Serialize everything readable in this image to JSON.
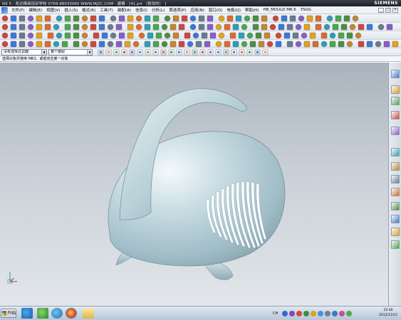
{
  "window": {
    "title": "NX 5 - 凯达模具培训学校  0769-88033060  WWW.MJZC.COM - 建模 - [41.prt （修改的） ]",
    "brand": "SIEMENS"
  },
  "menu": {
    "items": [
      "文件(F)",
      "编辑(E)",
      "视图(V)",
      "插入(S)",
      "格式(R)",
      "工具(T)",
      "装配(A)",
      "信息(I)",
      "分析(L)",
      "首选项(P)",
      "应用(N)",
      "窗口(O)",
      "电极(Q)",
      "帮助(H)",
      "HB_MOULD M6.6",
      "YSUG"
    ],
    "window_controls": [
      "_",
      "□",
      "×"
    ]
  },
  "selection_bar": {
    "filter_value": "没有选择过滤器",
    "scope_value": "整个装配"
  },
  "cue_line": "选择对象并使用 MB3，或者双击某一对象",
  "taskbar": {
    "start_label": "开始",
    "language": "CH",
    "clock_time": "22:40",
    "clock_date": "2012/11/15"
  },
  "colors": {
    "model_fill": "#b5cdd6",
    "viewport_top": "#aab3bd",
    "viewport_bottom": "#e2e6ea",
    "titlebar": "#1b1e25",
    "taskbar": "#b8c6d8"
  }
}
